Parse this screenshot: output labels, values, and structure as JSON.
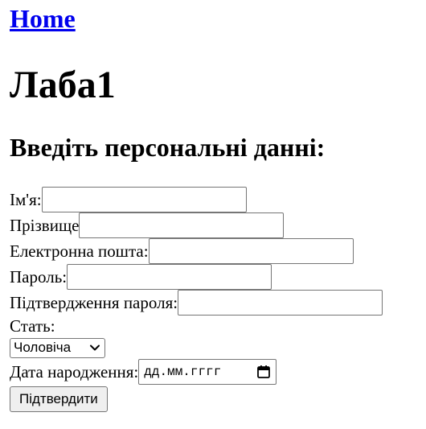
{
  "nav": {
    "home_label": "Home"
  },
  "page": {
    "title": "Лаба1",
    "subtitle": "Введіть персональні данні:"
  },
  "form": {
    "name_label": "Ім'я:",
    "name_value": "",
    "surname_label": "Прізвище",
    "surname_value": "",
    "email_label": "Електронна пошта:",
    "email_value": "",
    "password_label": "Пароль:",
    "password_value": "",
    "password_confirm_label": "Підтвердження пароля:",
    "password_confirm_value": "",
    "gender_label": "Стать:",
    "gender_selected": "Чоловіча",
    "birthdate_label": "Дата народження:",
    "birthdate_placeholder": "дд.мм.гггг",
    "submit_label": "Підтвердити"
  },
  "colors": {
    "link": "#0000ee",
    "button_bg": "#efefef",
    "field_border": "#767676"
  },
  "icons": {
    "select_arrow": "chevron-down-icon",
    "date_picker": "calendar-icon"
  }
}
